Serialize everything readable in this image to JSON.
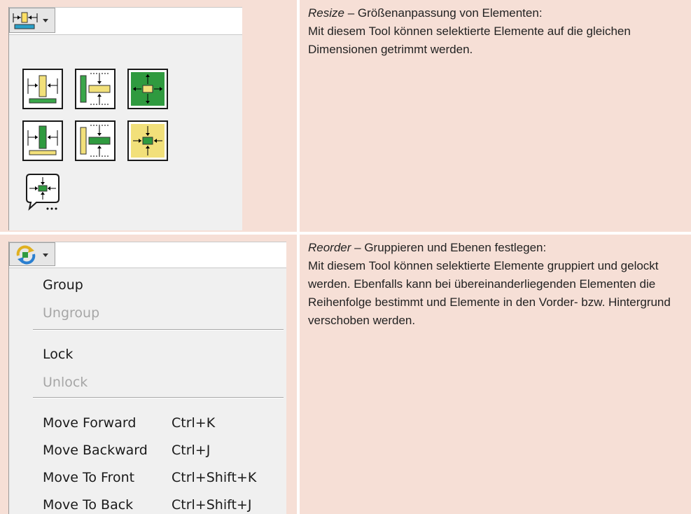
{
  "resize": {
    "title": "Resize",
    "title_suffix": " – Größenanpassung von Elementen:",
    "body": "Mit diesem Tool können selektierte Elemente auf die gleichen Dimensionen getrimmt werden.",
    "tool_icon": "resize-objects-icon",
    "tiles": [
      "match-width-icon",
      "match-height-icon",
      "max-size-icon",
      "min-width-icon",
      "min-height-icon",
      "min-size-icon",
      "set-size-dialog-icon"
    ]
  },
  "reorder": {
    "title": "Reorder",
    "title_suffix": " – Gruppieren und Ebenen festlegen:",
    "body": "Mit diesem Tool können selektierte Elemente gruppiert und gelockt werden. Ebenfalls kann bei übereinanderliegenden Elementen die Reihenfolge bestimmt und Elemente in den Vorder- bzw. Hintergrund verschoben werden.",
    "tool_icon": "reorder-icon",
    "menu": [
      {
        "label": "Group",
        "disabled": false
      },
      {
        "label": "Ungroup",
        "disabled": true
      },
      {
        "label": "Lock",
        "disabled": false
      },
      {
        "label": "Unlock",
        "disabled": true
      },
      {
        "label": "Move Forward",
        "shortcut": "Ctrl+K"
      },
      {
        "label": "Move Backward",
        "shortcut": "Ctrl+J"
      },
      {
        "label": "Move To Front",
        "shortcut": "Ctrl+Shift+K"
      },
      {
        "label": "Move To Back",
        "shortcut": "Ctrl+Shift+J"
      }
    ]
  }
}
